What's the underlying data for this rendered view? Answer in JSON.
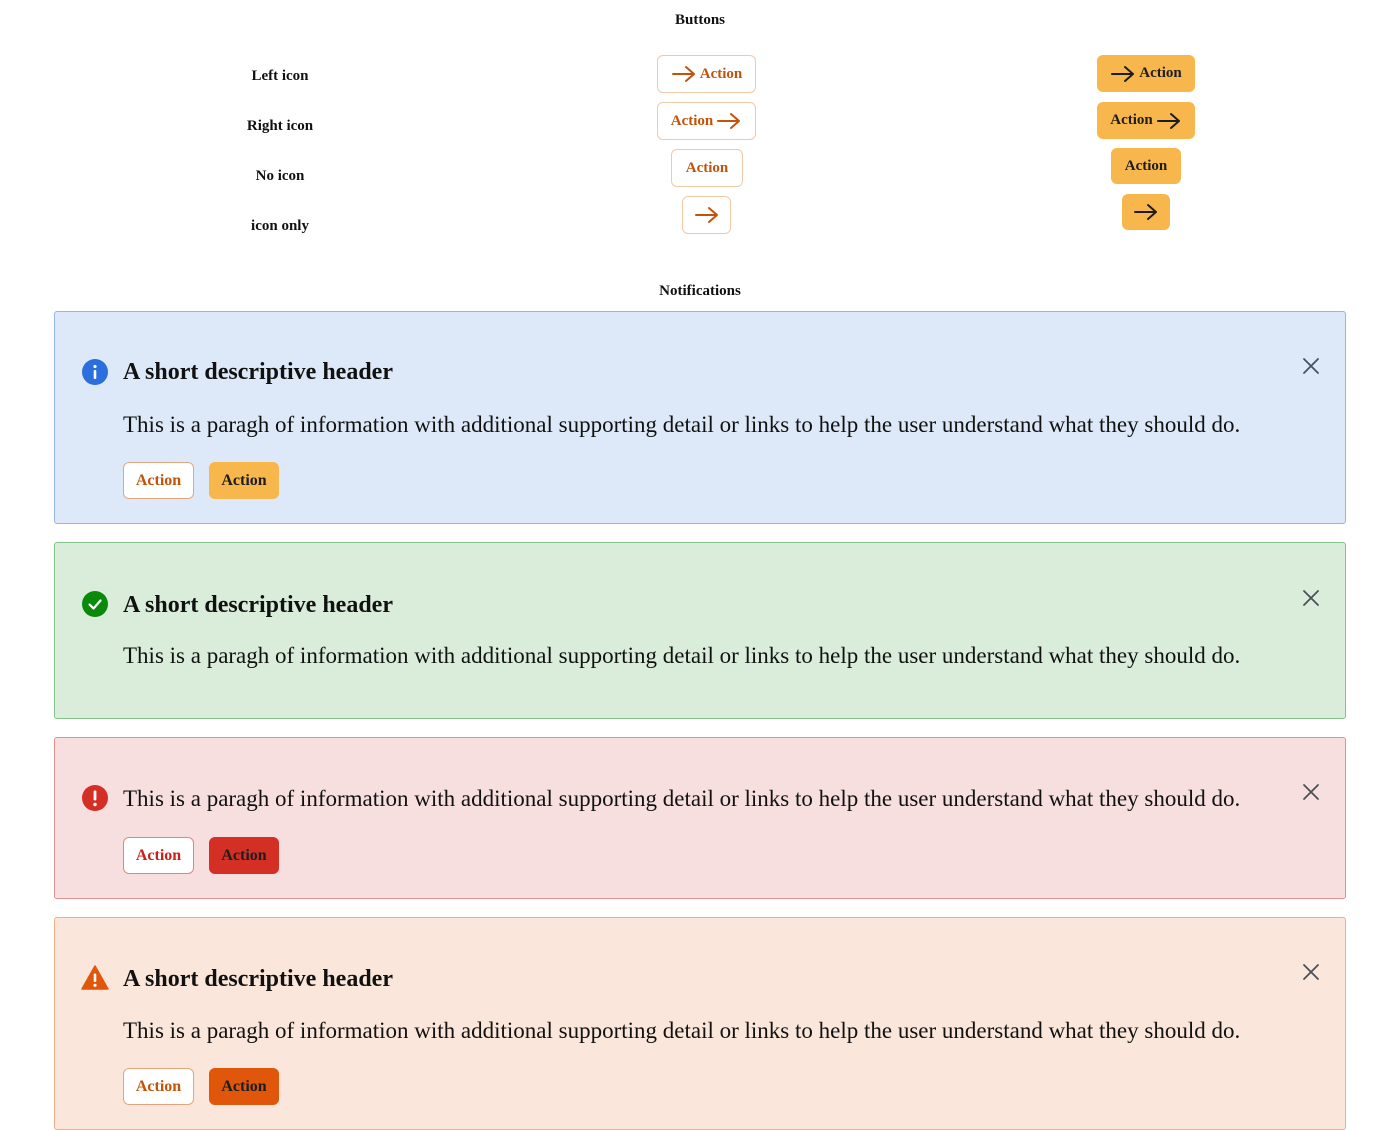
{
  "buttons_section": {
    "title": "Buttons",
    "rows": [
      {
        "label": "Left icon",
        "button_label": "Action",
        "icon": "arrow-right-icon"
      },
      {
        "label": "Right icon",
        "button_label": "Action",
        "icon": "arrow-right-icon"
      },
      {
        "label": "No icon",
        "button_label": "Action"
      },
      {
        "label": "icon only",
        "icon": "arrow-right-icon"
      }
    ]
  },
  "notifications_section": {
    "title": "Notifications",
    "items": [
      {
        "variant": "info",
        "icon": "info-icon",
        "header": "A short descriptive header",
        "body": "This is a paragh of information with additional supporting detail or links to help the user understand what they should do.",
        "secondary_action": "Action",
        "primary_action": "Action"
      },
      {
        "variant": "success",
        "icon": "check-circle-icon",
        "header": "A short descriptive header",
        "body": "This is a paragh of information with additional supporting detail or links to help the user understand what they should do."
      },
      {
        "variant": "error",
        "icon": "exclamation-circle-icon",
        "body": "This is a paragh of information with additional supporting detail or links to help the user understand what they should do.",
        "secondary_action": "Action",
        "primary_action": "Action"
      },
      {
        "variant": "warning",
        "icon": "warning-triangle-icon",
        "header": "A short descriptive header",
        "body": "This is a paragh of information with additional supporting detail or links to help the user understand what they should do.",
        "secondary_action": "Action",
        "primary_action": "Action"
      }
    ]
  },
  "colors": {
    "accent_orange": "#c2530a",
    "primary_button": "#f8b74c",
    "info_bg": "#dde9f8",
    "info_icon": "#2a6fdb",
    "success_bg": "#daeddb",
    "success_icon": "#0a8a0a",
    "error_bg": "#f7dfdf",
    "error_icon": "#d42f25",
    "warning_bg": "#fae6da",
    "warning_icon": "#e0560b"
  }
}
